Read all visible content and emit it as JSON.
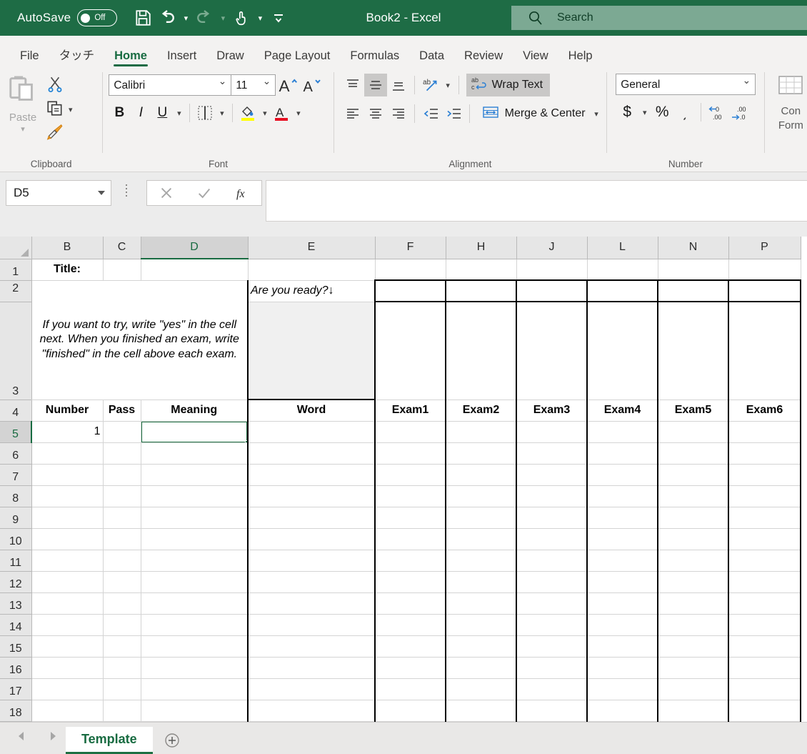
{
  "titlebar": {
    "autosave_label": "AutoSave",
    "autosave_state": "Off",
    "document_title": "Book2  -  Excel",
    "search_placeholder": "Search",
    "qat": [
      "save-icon",
      "undo-icon",
      "redo-icon",
      "touch-mode-icon",
      "customize-qat-icon"
    ]
  },
  "tabs": [
    {
      "label": "File",
      "active": false
    },
    {
      "label": "タッチ",
      "active": false
    },
    {
      "label": "Home",
      "active": true
    },
    {
      "label": "Insert",
      "active": false
    },
    {
      "label": "Draw",
      "active": false
    },
    {
      "label": "Page Layout",
      "active": false
    },
    {
      "label": "Formulas",
      "active": false
    },
    {
      "label": "Data",
      "active": false
    },
    {
      "label": "Review",
      "active": false
    },
    {
      "label": "View",
      "active": false
    },
    {
      "label": "Help",
      "active": false
    }
  ],
  "ribbon": {
    "clipboard": {
      "label": "Clipboard",
      "paste_label": "Paste",
      "cut_label": "Cut",
      "copy_label": "Copy",
      "format_painter_label": "Format Painter"
    },
    "font": {
      "label": "Font",
      "font_name": "Calibri",
      "font_size": "11",
      "bold": "B",
      "italic": "I",
      "underline": "U",
      "grow_label": "A",
      "shrink_label": "A",
      "fill_color": "#FFFF00",
      "font_color": "#E81123"
    },
    "alignment": {
      "label": "Alignment",
      "wrap_text_label": "Wrap Text",
      "merge_center_label": "Merge & Center",
      "wrap_text_active": true,
      "middle_align_active": true
    },
    "number": {
      "label": "Number",
      "format": "General",
      "currency": "$",
      "percent": "%",
      "comma": "͵",
      "increase_decimal": ".00",
      "decrease_decimal": ".00"
    },
    "styles": {
      "conditional_formatting_line1": "Con",
      "conditional_formatting_line2": "Form"
    }
  },
  "formula_bar": {
    "name_box": "D5",
    "cancel_icon": "cancel-icon",
    "enter_icon": "confirm-icon",
    "fx_icon": "insert-function-icon",
    "formula_value": ""
  },
  "grid": {
    "columns": [
      "B",
      "C",
      "D",
      "E",
      "F",
      "H",
      "J",
      "L",
      "N",
      "P"
    ],
    "selected_column": "D",
    "selected_row": "5",
    "selected_cell": "D5",
    "rows": [
      "1",
      "2",
      "3",
      "4",
      "5",
      "6",
      "7",
      "8",
      "9",
      "10",
      "11",
      "12",
      "13",
      "14",
      "15",
      "16",
      "17",
      "18"
    ],
    "cells": {
      "B1": "Title:",
      "B2_merged": "If you want to try, write \"yes\" in the cell next. When you finished an exam, write \"finished\" in the cell above each exam.",
      "E2": "Are you ready?↓",
      "E3": "",
      "B4": "Number",
      "C4": "Pass",
      "D4": "Meaning",
      "E4": "Word",
      "F4": "Exam1",
      "H4": "Exam2",
      "J4": "Exam3",
      "L4": "Exam4",
      "N4": "Exam5",
      "P4": "Exam6",
      "B5": "1",
      "D5": ""
    }
  },
  "sheet_tabs": {
    "prev_icon": "prev-sheet-icon",
    "next_icon": "next-sheet-icon",
    "sheets": [
      "Template"
    ],
    "active_sheet": "Template",
    "add_icon": "add-sheet-icon"
  },
  "colors": {
    "brand_green": "#1e6c45",
    "accent_green": "#1d6f42",
    "ribbon_bg": "#f3f2f1",
    "header_bg": "#e6e6e6",
    "cell_gray": "#f0f0f0"
  }
}
